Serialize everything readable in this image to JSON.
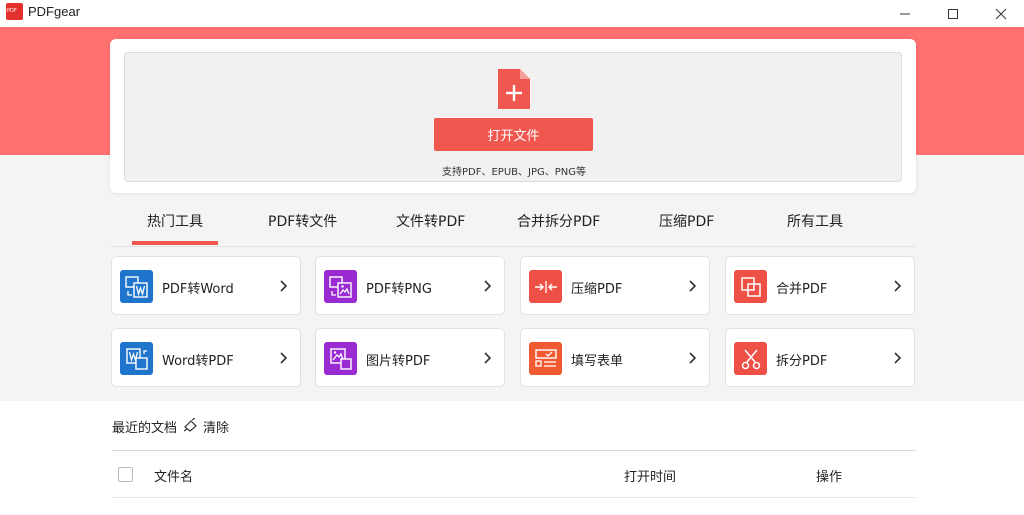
{
  "window": {
    "title": "PDFgear",
    "logo_text": "PDF"
  },
  "open_panel": {
    "open_button": "打开文件",
    "formats": "支持PDF、EPUB、JPG、PNG等"
  },
  "tabs": [
    {
      "label": "热门工具",
      "active": true
    },
    {
      "label": "PDF转文件"
    },
    {
      "label": "文件转PDF"
    },
    {
      "label": "合并拆分PDF"
    },
    {
      "label": "压缩PDF"
    },
    {
      "label": "所有工具"
    }
  ],
  "tools": [
    {
      "label": "PDF转Word",
      "icon": "pdf-to-word-icon",
      "color": "#1f74cc"
    },
    {
      "label": "PDF转PNG",
      "icon": "pdf-to-png-icon",
      "color": "#9a2bd3"
    },
    {
      "label": "压缩PDF",
      "icon": "compress-icon",
      "color": "#ee5046"
    },
    {
      "label": "合并PDF",
      "icon": "merge-icon",
      "color": "#ee5046"
    },
    {
      "label": "Word转PDF",
      "icon": "word-to-pdf-icon",
      "color": "#1f74cc"
    },
    {
      "label": "图片转PDF",
      "icon": "image-to-pdf-icon",
      "color": "#9a2bd3"
    },
    {
      "label": "填写表单",
      "icon": "fill-form-icon",
      "color": "#f05a33"
    },
    {
      "label": "拆分PDF",
      "icon": "split-icon",
      "color": "#ee5046"
    }
  ],
  "recent": {
    "title": "最近的文档",
    "clear_label": "清除",
    "columns": {
      "name": "文件名",
      "opened": "打开时间",
      "actions": "操作"
    }
  },
  "colors": {
    "banner": "#ff7070",
    "accent": "#f0574f"
  }
}
